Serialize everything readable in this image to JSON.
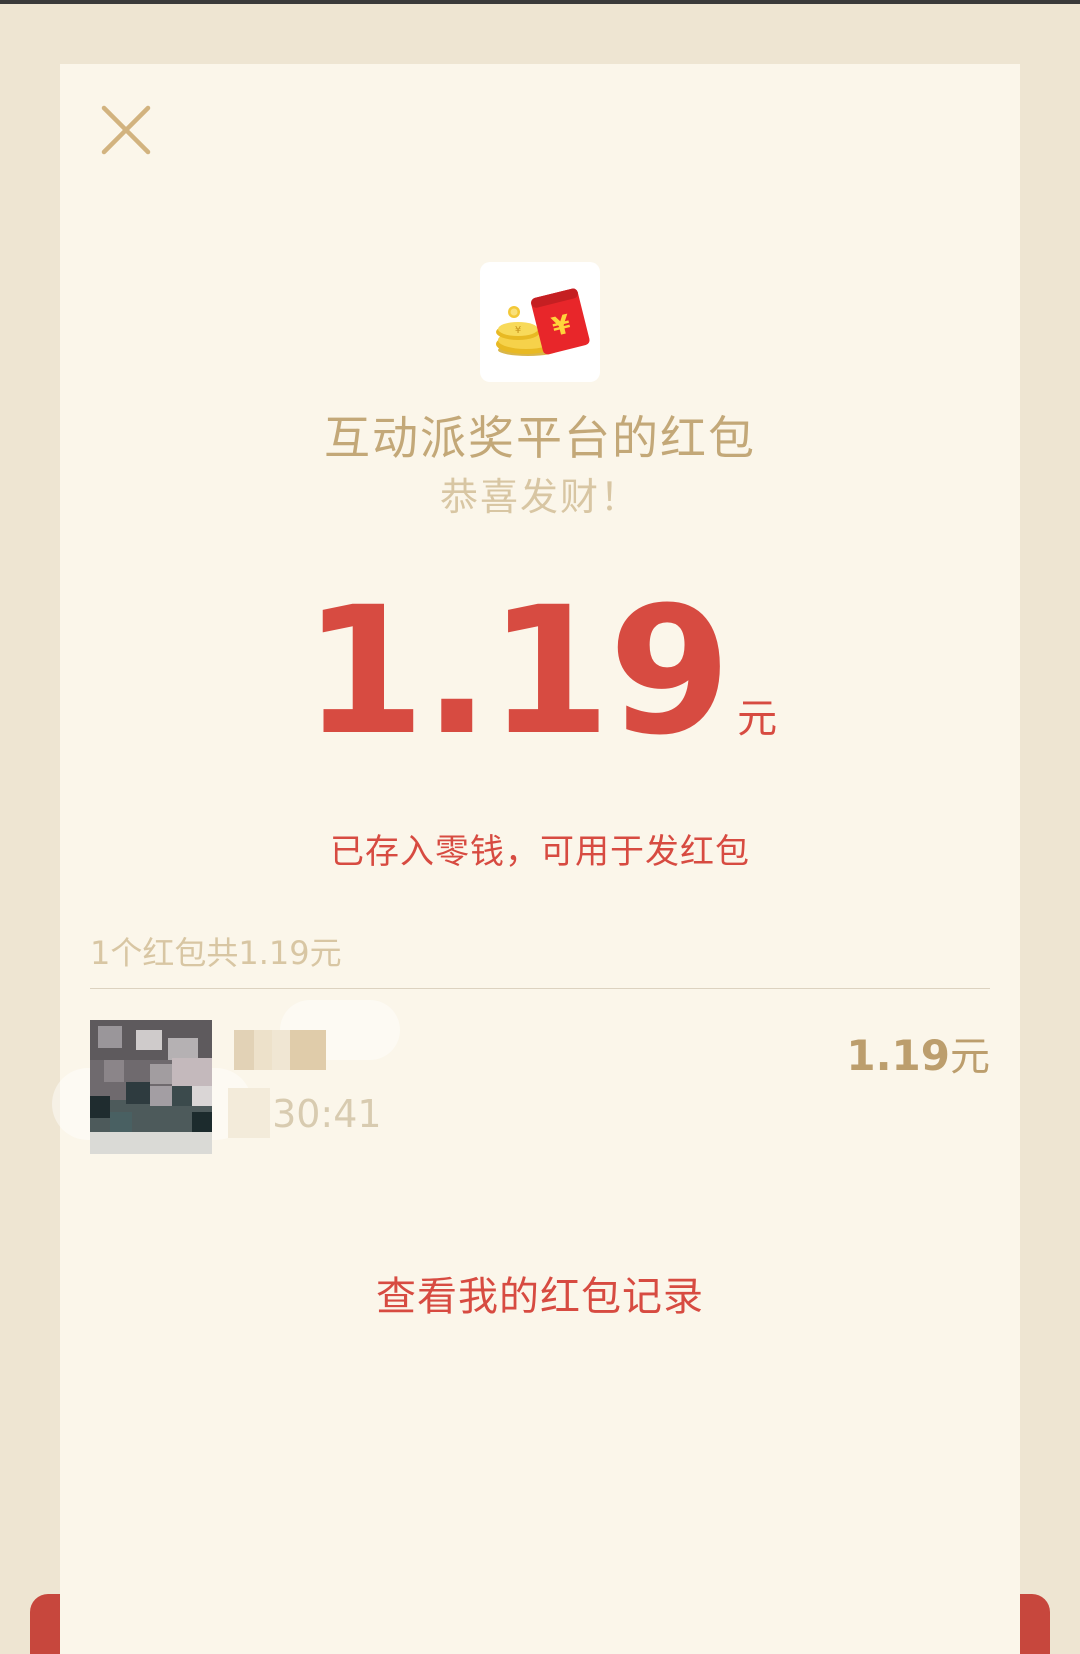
{
  "dialog": {
    "sender_title": "互动派奖平台的红包",
    "greeting": "恭喜发财！",
    "amount": "1.19",
    "amount_unit": "元",
    "saved_note": "已存入零钱，可用于发红包",
    "summary": "1个红包共1.19元",
    "records_link": "查看我的红包记录"
  },
  "receiver": {
    "time": ".30:41",
    "amount": "1.19",
    "amount_unit": "元"
  },
  "icons": {
    "close": "close-icon",
    "app": "red-packet-coins-icon"
  },
  "colors": {
    "accent_red": "#D74B41",
    "gold_text": "#C3A878",
    "sheet_bg": "#FBF6EA",
    "page_bg": "#EEE5D2"
  }
}
